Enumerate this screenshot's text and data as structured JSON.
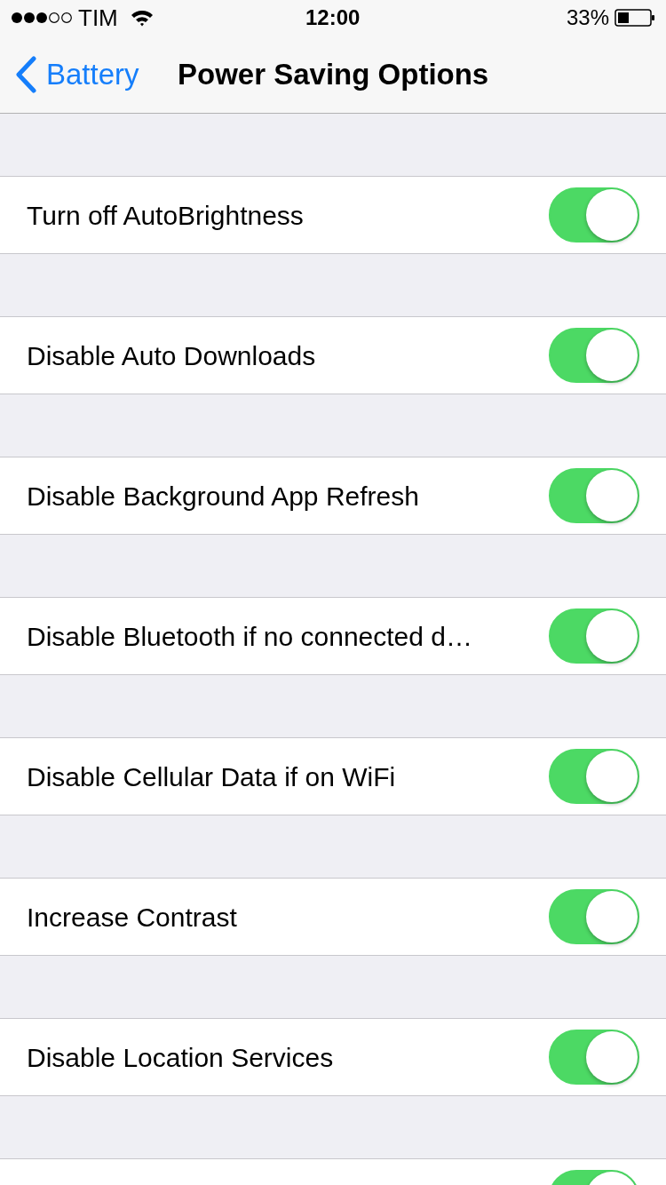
{
  "status_bar": {
    "carrier": "TIM",
    "time": "12:00",
    "battery": "33%"
  },
  "nav_bar": {
    "back": "Battery",
    "title": "Power Saving Options"
  },
  "settings": [
    {
      "label": "Turn off AutoBrightness",
      "on": true
    },
    {
      "label": "Disable Auto Downloads",
      "on": true
    },
    {
      "label": "Disable Background App Refresh",
      "on": true
    },
    {
      "label": "Disable Bluetooth if no connected d…",
      "on": true
    },
    {
      "label": "Disable Cellular Data if on WiFi",
      "on": true
    },
    {
      "label": "Increase Contrast",
      "on": true
    },
    {
      "label": "Disable Location Services",
      "on": true
    },
    {
      "on": true
    }
  ]
}
